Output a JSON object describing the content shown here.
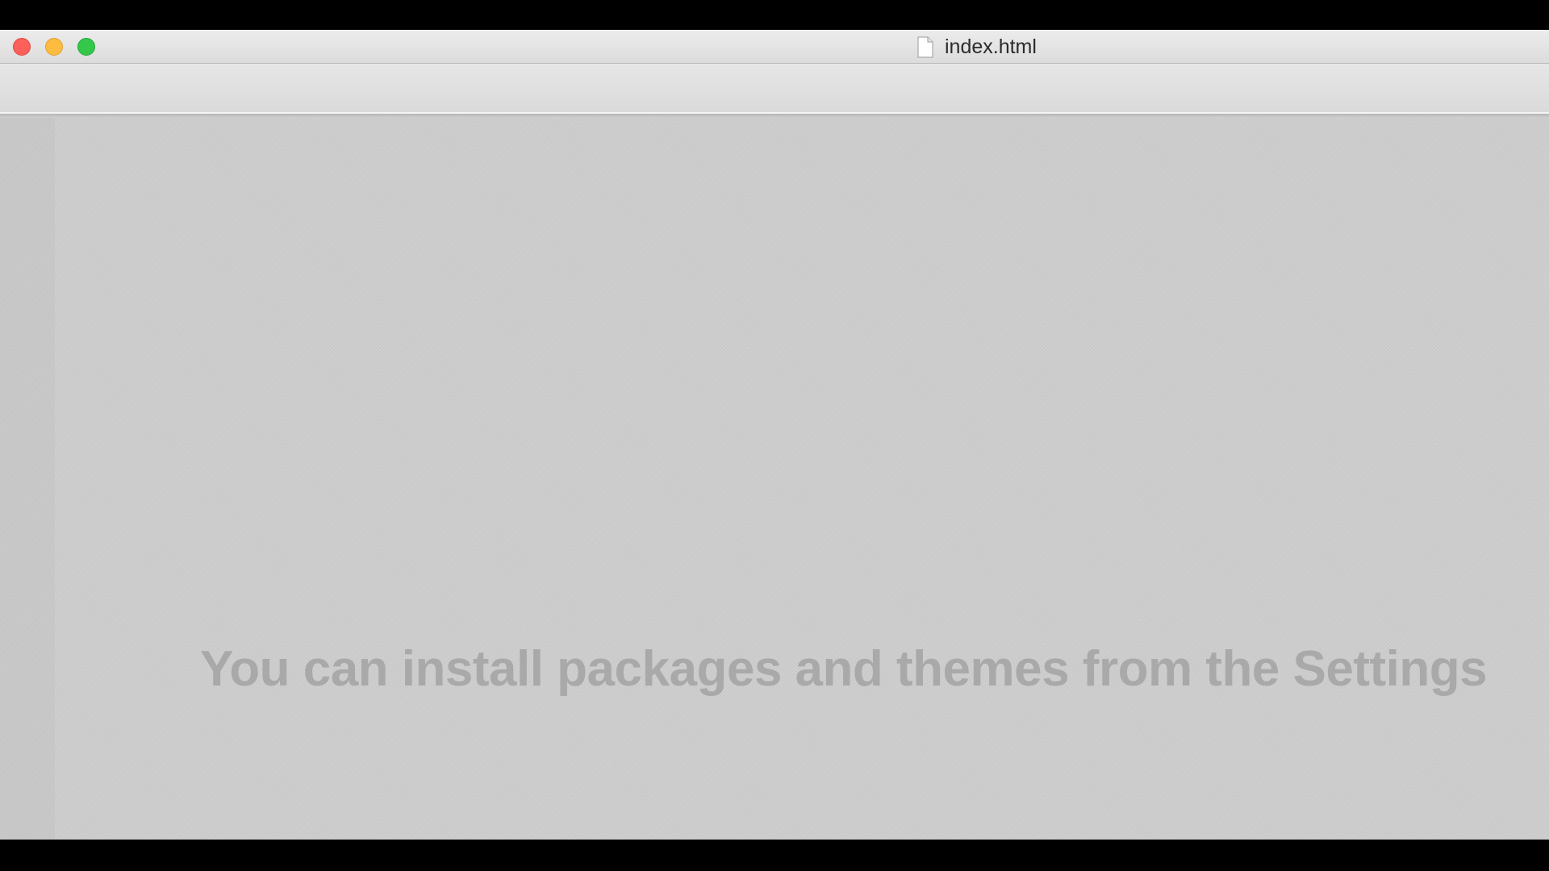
{
  "window": {
    "title": "index.html",
    "file_icon": "document-icon"
  },
  "traffic_lights": {
    "close_color": "#fc605b",
    "minimize_color": "#fdbc40",
    "zoom_color": "#34c84a"
  },
  "editor": {
    "placeholder": "You can install packages and themes from the Settings"
  }
}
